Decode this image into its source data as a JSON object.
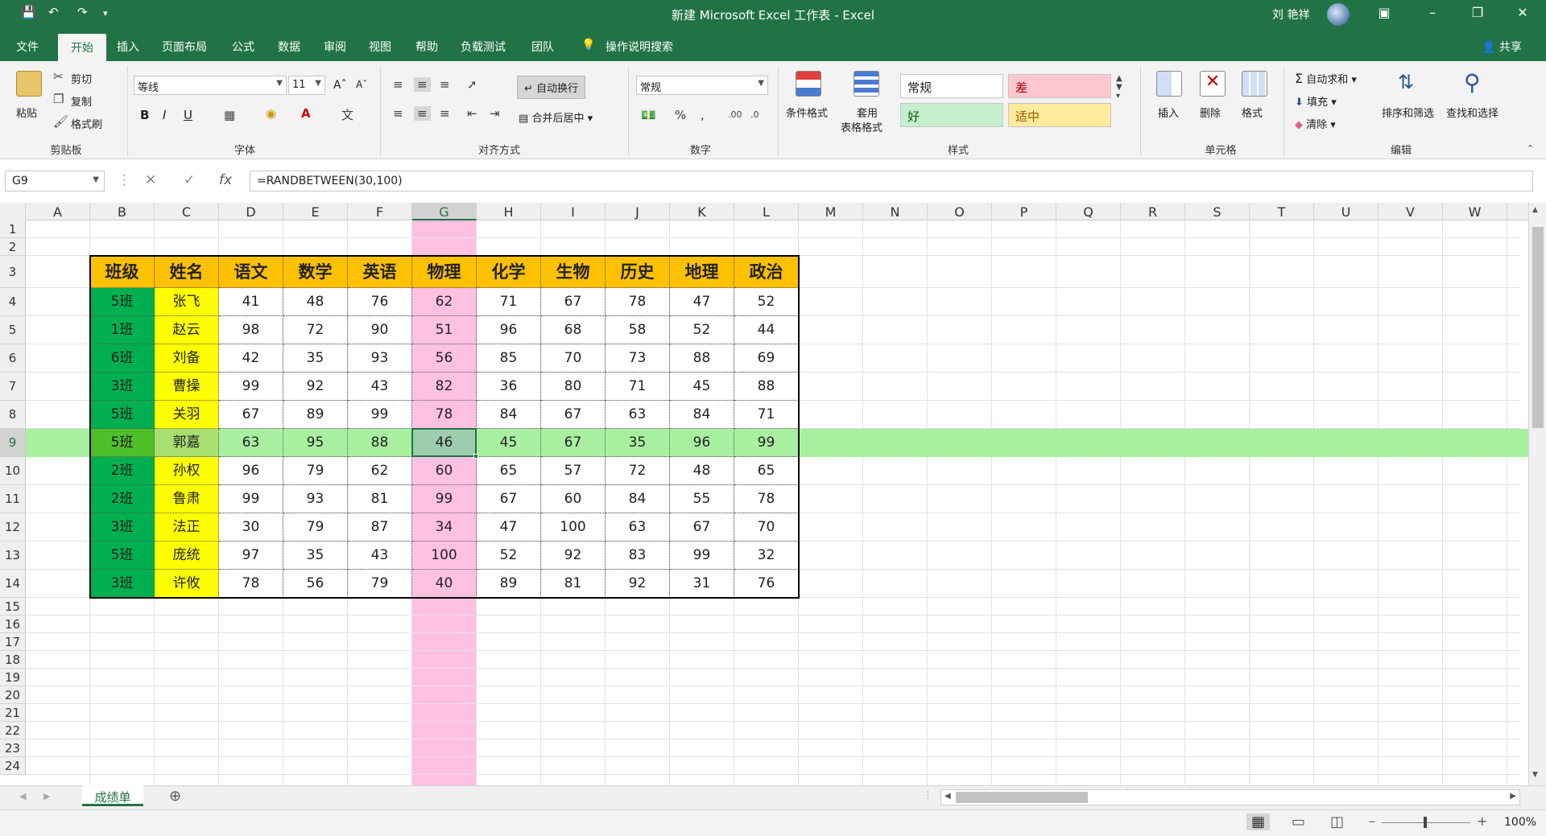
{
  "window": {
    "title": "新建 Microsoft Excel 工作表 - Excel",
    "user": "刘 艳祥",
    "quick_access": [
      "save-icon",
      "undo-icon",
      "redo-icon",
      "customize-icon"
    ]
  },
  "tabs": [
    "文件",
    "开始",
    "插入",
    "页面布局",
    "公式",
    "数据",
    "审阅",
    "视图",
    "帮助",
    "负载测试",
    "团队"
  ],
  "active_tab": "开始",
  "tell_me": "操作说明搜索",
  "share": "共享",
  "ribbon": {
    "clipboard": {
      "label": "剪贴板",
      "paste": "粘贴",
      "cut": "剪切",
      "copy": "复制",
      "format_painter": "格式刷"
    },
    "font": {
      "label": "字体",
      "name": "等线",
      "size": "11",
      "bold": "B",
      "italic": "I",
      "underline": "U"
    },
    "alignment": {
      "label": "对齐方式",
      "wrap": "自动换行",
      "merge": "合并后居中"
    },
    "number": {
      "label": "数字",
      "format": "常规"
    },
    "styles": {
      "label": "样式",
      "conditional": "条件格式",
      "table": "套用",
      "table2": "表格格式",
      "normal": "常规",
      "bad": "差",
      "good": "好",
      "neutral": "适中"
    },
    "cells": {
      "label": "单元格",
      "insert": "插入",
      "delete": "删除",
      "format": "格式"
    },
    "editing": {
      "label": "编辑",
      "autosum": "自动求和",
      "fill": "填充",
      "clear": "清除",
      "sort": "排序和筛选",
      "find": "查找和选择"
    }
  },
  "formula_bar": {
    "name_box": "G9",
    "formula": "=RANDBETWEEN(30,100)",
    "fx": "fx"
  },
  "grid": {
    "columns": [
      "A",
      "B",
      "C",
      "D",
      "E",
      "F",
      "G",
      "H",
      "I",
      "J",
      "K",
      "L",
      "M",
      "N",
      "O",
      "P",
      "Q",
      "R",
      "S",
      "T",
      "U",
      "V",
      "W"
    ],
    "selected_column": "G",
    "selected_row": 9,
    "row_numbers": [
      1,
      2,
      3,
      4,
      5,
      6,
      7,
      8,
      9,
      10,
      11,
      12,
      13,
      14,
      15,
      16,
      17,
      18,
      19,
      20,
      21,
      22,
      23,
      24
    ],
    "table_headers": [
      "班级",
      "姓名",
      "语文",
      "数学",
      "英语",
      "物理",
      "化学",
      "生物",
      "历史",
      "地理",
      "政治"
    ],
    "table_rows": [
      [
        "5班",
        "张飞",
        "41",
        "48",
        "76",
        "62",
        "71",
        "67",
        "78",
        "47",
        "52"
      ],
      [
        "1班",
        "赵云",
        "98",
        "72",
        "90",
        "51",
        "96",
        "68",
        "58",
        "52",
        "44"
      ],
      [
        "6班",
        "刘备",
        "42",
        "35",
        "93",
        "56",
        "85",
        "70",
        "73",
        "88",
        "69"
      ],
      [
        "3班",
        "曹操",
        "99",
        "92",
        "43",
        "82",
        "36",
        "80",
        "71",
        "45",
        "88"
      ],
      [
        "5班",
        "关羽",
        "67",
        "89",
        "99",
        "78",
        "84",
        "67",
        "63",
        "84",
        "71"
      ],
      [
        "5班",
        "郭嘉",
        "63",
        "95",
        "88",
        "46",
        "45",
        "67",
        "35",
        "96",
        "99"
      ],
      [
        "2班",
        "孙权",
        "96",
        "79",
        "62",
        "60",
        "65",
        "57",
        "72",
        "48",
        "65"
      ],
      [
        "2班",
        "鲁肃",
        "99",
        "93",
        "81",
        "99",
        "67",
        "60",
        "84",
        "55",
        "78"
      ],
      [
        "3班",
        "法正",
        "30",
        "79",
        "87",
        "34",
        "47",
        "100",
        "63",
        "67",
        "70"
      ],
      [
        "5班",
        "庞统",
        "97",
        "35",
        "43",
        "100",
        "52",
        "92",
        "83",
        "99",
        "32"
      ],
      [
        "3班",
        "许攸",
        "78",
        "56",
        "79",
        "40",
        "89",
        "81",
        "92",
        "31",
        "76"
      ]
    ],
    "colors": {
      "header_fill": "#ffc000",
      "class_fill": "#00b050",
      "name_fill": "#ffff00",
      "physics_fill": "#ffc0e2",
      "highlight_row": "#a8f0a0",
      "selected_cell": "#9fcdb0"
    }
  },
  "sheets": [
    "成绩单"
  ],
  "status": {
    "zoom": "100%"
  }
}
